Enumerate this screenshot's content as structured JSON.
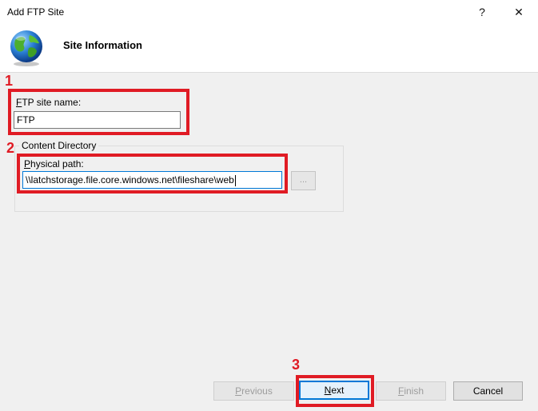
{
  "window": {
    "title": "Add FTP Site",
    "help_glyph": "?",
    "close_glyph": "✕"
  },
  "header": {
    "title": "Site Information",
    "icon": "globe-icon"
  },
  "form": {
    "ftp_site_name": {
      "label_accel": "F",
      "label_rest": "TP site name:",
      "value": "FTP"
    },
    "content_directory": {
      "legend": "Content Directory",
      "physical_path": {
        "label_accel": "P",
        "label_rest": "hysical path:",
        "value": "\\\\latchstorage.file.core.windows.net\\fileshare\\web"
      },
      "browse_label": "..."
    }
  },
  "annotations": {
    "step1": "1",
    "step2": "2",
    "step3": "3",
    "color": "#e01b24"
  },
  "buttons": {
    "previous": {
      "accel": "P",
      "rest": "revious"
    },
    "next": {
      "accel": "N",
      "rest": "ext"
    },
    "finish": {
      "accel": "F",
      "rest": "inish"
    },
    "cancel": "Cancel"
  },
  "colors": {
    "content_bg": "#f0f0f0",
    "default_button_border": "#0078d7"
  }
}
